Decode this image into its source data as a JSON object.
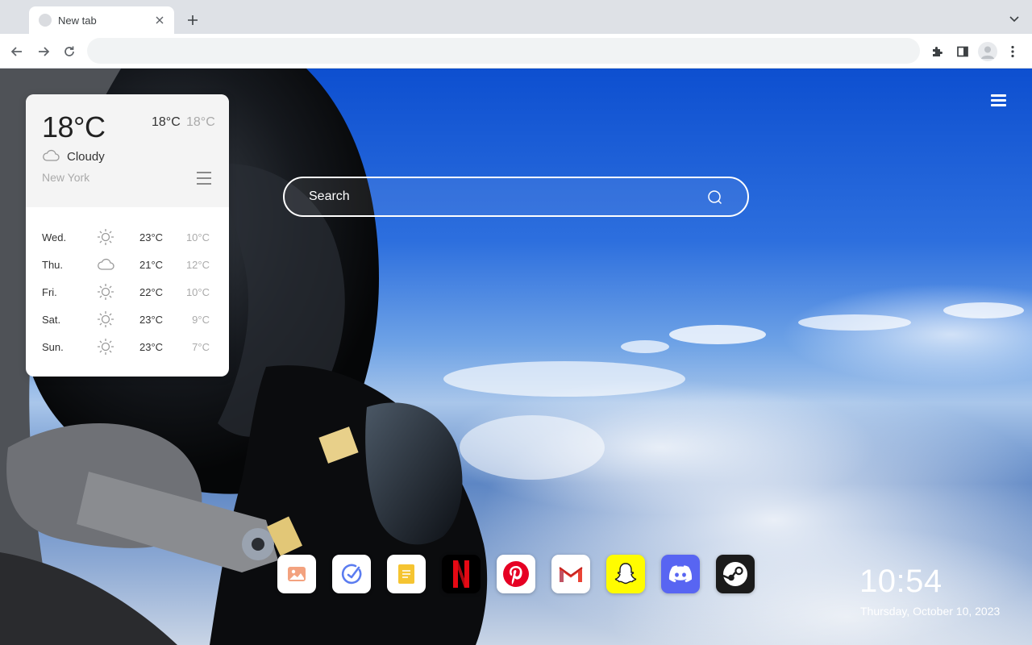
{
  "browser": {
    "tab": {
      "title": "New tab"
    },
    "omnibox": {
      "value": "",
      "placeholder": ""
    }
  },
  "weather": {
    "current_temp": "18°C",
    "high": "18°C",
    "low": "18°C",
    "condition": "Cloudy",
    "condition_icon": "cloud-icon",
    "city": "New York",
    "forecast": [
      {
        "day": "Wed.",
        "icon": "sun-icon",
        "high": "23°C",
        "low": "10°C"
      },
      {
        "day": "Thu.",
        "icon": "cloud-icon",
        "high": "21°C",
        "low": "12°C"
      },
      {
        "day": "Fri.",
        "icon": "sun-icon",
        "high": "22°C",
        "low": "10°C"
      },
      {
        "day": "Sat.",
        "icon": "sun-icon",
        "high": "23°C",
        "low": "9°C"
      },
      {
        "day": "Sun.",
        "icon": "sun-icon",
        "high": "23°C",
        "low": "7°C"
      }
    ]
  },
  "search": {
    "placeholder": "Search"
  },
  "dock": {
    "apps": [
      {
        "id": "photos",
        "icon": "picture-icon",
        "bg": "#ffffff",
        "accent": "#f08060"
      },
      {
        "id": "tasks",
        "icon": "check-icon",
        "bg": "#ffffff",
        "accent": "#5b7cf0"
      },
      {
        "id": "notes",
        "icon": "note-icon",
        "bg": "#ffffff",
        "accent": "#f5c431"
      },
      {
        "id": "netflix",
        "icon": "netflix-icon",
        "bg": "#000000",
        "accent": "#e50914"
      },
      {
        "id": "pinterest",
        "icon": "pinterest-icon",
        "bg": "#ffffff",
        "accent": "#e60023"
      },
      {
        "id": "gmail",
        "icon": "gmail-icon",
        "bg": "#ffffff",
        "accent": "#ea4335"
      },
      {
        "id": "snapchat",
        "icon": "snapchat-icon",
        "bg": "#fffc00",
        "accent": "#ffffff"
      },
      {
        "id": "discord",
        "icon": "discord-icon",
        "bg": "#5865f2",
        "accent": "#ffffff"
      },
      {
        "id": "steam",
        "icon": "steam-icon",
        "bg": "#1b1b1b",
        "accent": "#ffffff"
      }
    ]
  },
  "clock": {
    "time": "10:54",
    "date": "Thursday, October 10, 2023"
  }
}
